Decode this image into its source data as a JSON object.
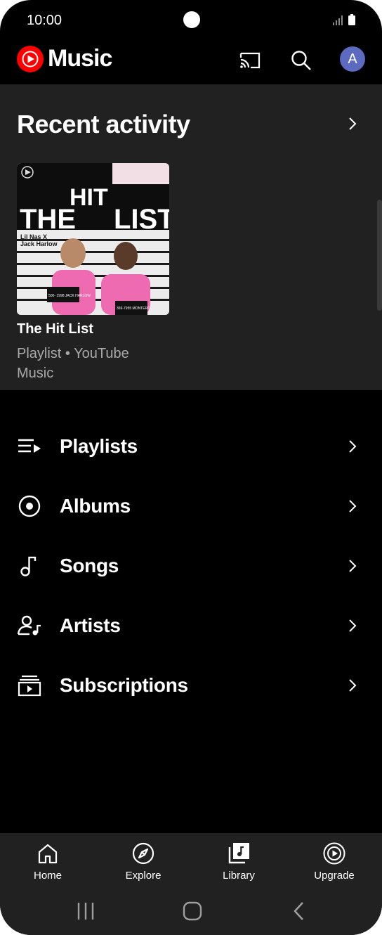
{
  "status_bar": {
    "time": "10:00"
  },
  "header": {
    "logo_text": "Music",
    "avatar_initial": "A"
  },
  "recent_activity": {
    "title": "Recent activity",
    "item": {
      "title": "The Hit List",
      "subtitle": "Playlist • YouTube Music",
      "art_text_left": "THE",
      "art_text_mid": "HIT",
      "art_text_right": "LIST",
      "art_artist_1": "Lil Nas X",
      "art_artist_2": "Jack Harlow",
      "art_plate_1": "500- 1998 JACK HARLOW",
      "art_plate_2": "369-7955 MONTERO"
    }
  },
  "library": {
    "items": [
      {
        "label": "Playlists",
        "icon": "playlist-icon"
      },
      {
        "label": "Albums",
        "icon": "album-icon"
      },
      {
        "label": "Songs",
        "icon": "music-note-icon"
      },
      {
        "label": "Artists",
        "icon": "artist-icon"
      },
      {
        "label": "Subscriptions",
        "icon": "subscriptions-icon"
      }
    ]
  },
  "bottom_nav": {
    "tabs": [
      {
        "label": "Home",
        "icon": "home-icon"
      },
      {
        "label": "Explore",
        "icon": "compass-icon"
      },
      {
        "label": "Library",
        "icon": "library-icon",
        "selected": true
      },
      {
        "label": "Upgrade",
        "icon": "upgrade-icon"
      }
    ]
  },
  "colors": {
    "brand_red": "#ff0000",
    "surface": "#212121",
    "background": "#000000",
    "avatar": "#5c6bc0",
    "subtext": "#aaaaaa"
  }
}
